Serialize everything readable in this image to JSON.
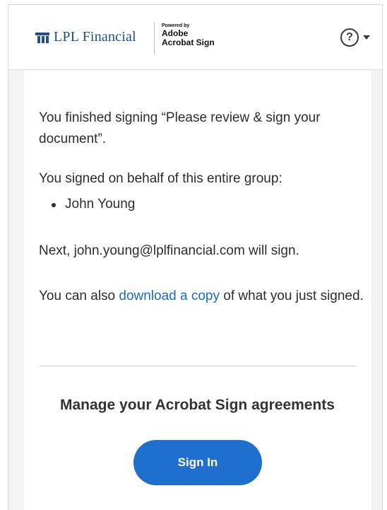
{
  "header": {
    "brand_name": "LPL Financial",
    "powered_by_small": "Powered by",
    "powered_by_brand_line1": "Adobe",
    "powered_by_brand_line2": "Acrobat Sign",
    "help_icon": "question-circle-icon",
    "menu_icon": "chevron-down-icon",
    "brand_color": "#1d4f91"
  },
  "content": {
    "finished_text": "You finished signing “Please review & sign your document”.",
    "group_intro": "You signed on behalf of this entire group:",
    "group_members": [
      "John Young"
    ],
    "next_signer_text": "Next, john.young@lplfinancial.com will sign.",
    "download_prefix": "You can also ",
    "download_link": "download a copy",
    "download_suffix": " of what you just signed.",
    "link_color": "#1a6bc6"
  },
  "footer": {
    "manage_title": "Manage your Acrobat Sign agreements",
    "signin_label": "Sign In",
    "button_color": "#1e6fce"
  }
}
